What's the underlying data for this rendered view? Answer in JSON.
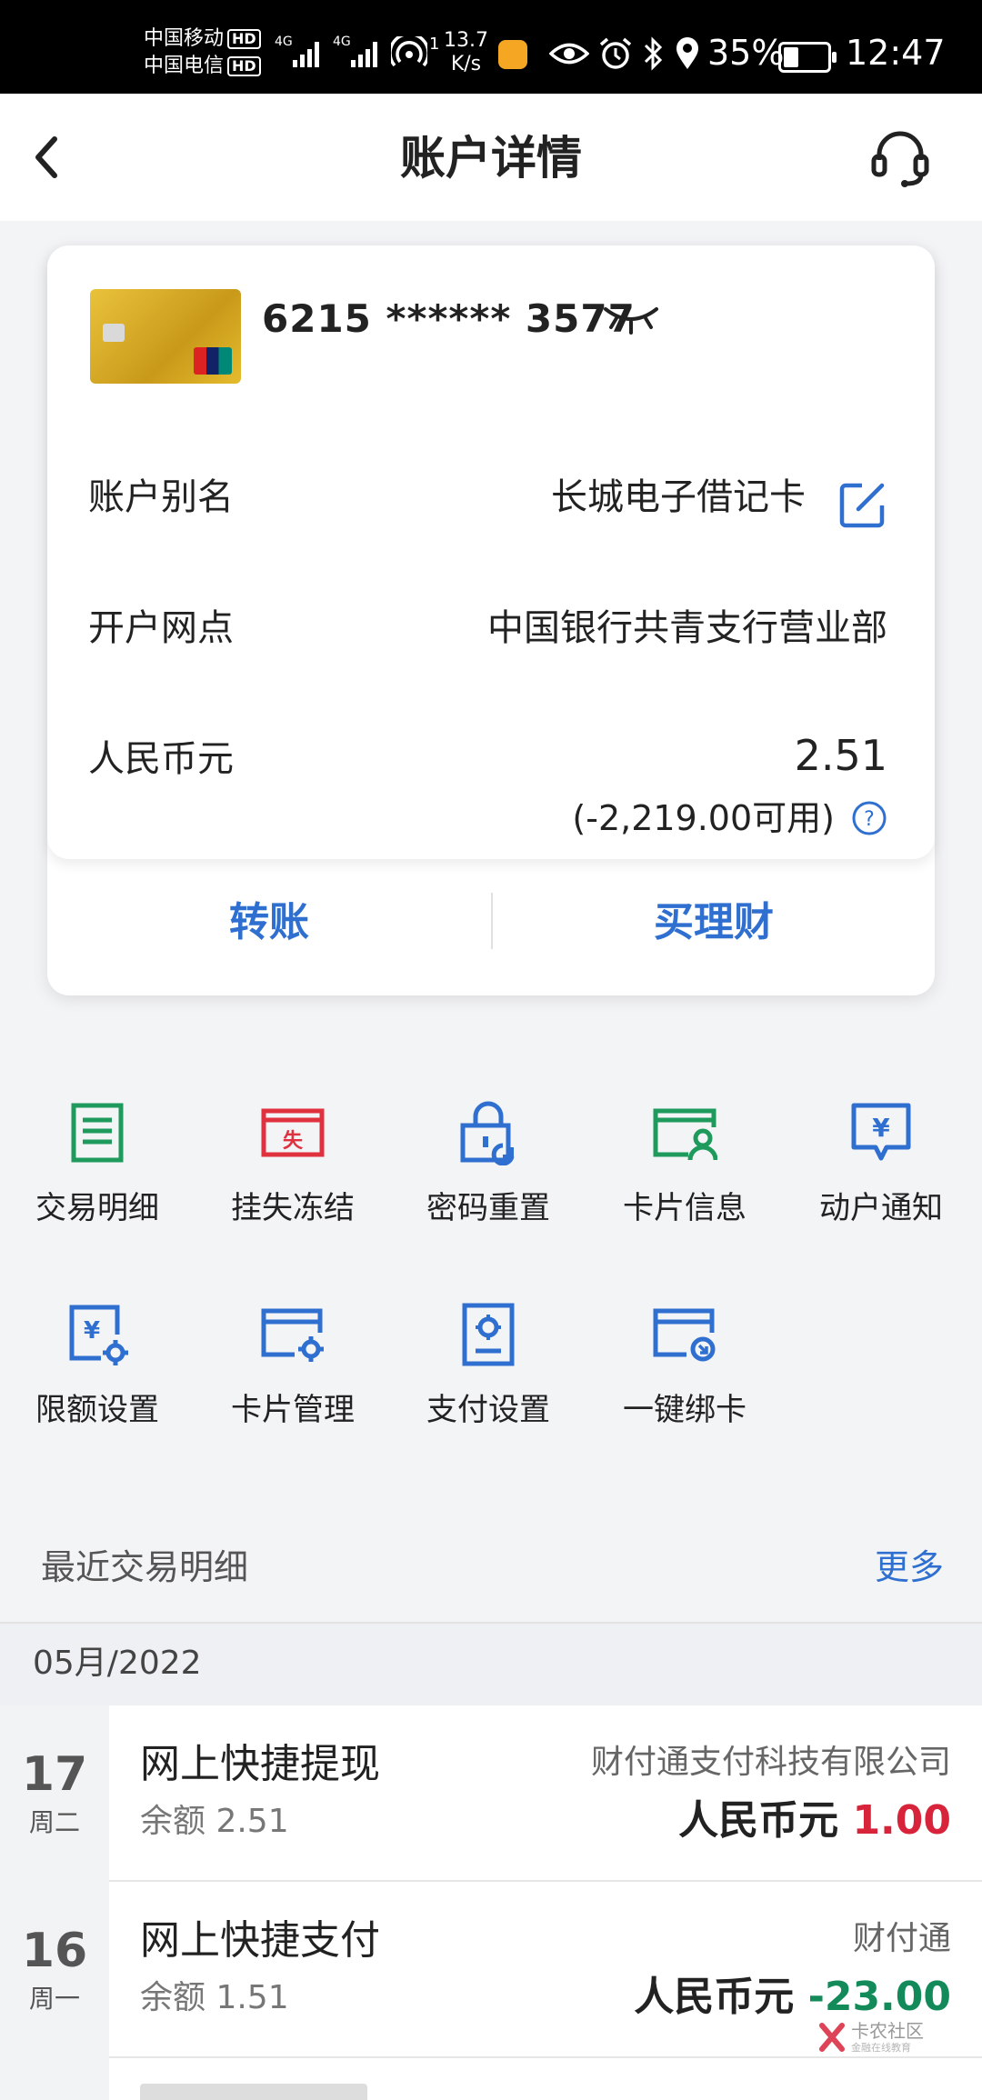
{
  "status_bar": {
    "carrier1": "中国移动",
    "carrier2": "中国电信",
    "hd": "HD",
    "net1": "4G",
    "net2": "4G",
    "hotspot_count": "1",
    "speed_value": "13.7",
    "speed_unit": "K/s",
    "battery": "35%",
    "time": "12:47"
  },
  "header": {
    "title": "账户详情"
  },
  "account": {
    "card_number": "6215 ****** 3577",
    "rows": [
      {
        "label": "账户别名",
        "value": "长城电子借记卡"
      },
      {
        "label": "开户网点",
        "value": "中国银行共青支行营业部"
      },
      {
        "label": "人民币元",
        "value": "2.51"
      }
    ],
    "available": "(-2,219.00可用)"
  },
  "actions": {
    "transfer": "转账",
    "wealth": "买理财"
  },
  "services": [
    {
      "label": "交易明细",
      "icon": "list-icon",
      "color": "#1e9a5c"
    },
    {
      "label": "挂失冻结",
      "icon": "lost-card-icon",
      "color": "#e0313e"
    },
    {
      "label": "密码重置",
      "icon": "lock-reset-icon",
      "color": "#2f6fd0"
    },
    {
      "label": "卡片信息",
      "icon": "card-user-icon",
      "color": "#1e9a5c"
    },
    {
      "label": "动户通知",
      "icon": "yuan-notify-icon",
      "color": "#2f6fd0"
    },
    {
      "label": "限额设置",
      "icon": "yuan-gear-icon",
      "color": "#2f6fd0"
    },
    {
      "label": "卡片管理",
      "icon": "card-gear-icon",
      "color": "#2f6fd0"
    },
    {
      "label": "支付设置",
      "icon": "pay-settings-icon",
      "color": "#2f6fd0"
    },
    {
      "label": "一键绑卡",
      "icon": "card-bind-icon",
      "color": "#2f6fd0"
    }
  ],
  "recent": {
    "title": "最近交易明细",
    "more": "更多",
    "month": "05月/2022",
    "transactions": [
      {
        "day": "17",
        "weekday": "周二",
        "name": "网上快捷提现",
        "balance": "余额 2.51",
        "party": "财付通支付科技有限公司",
        "currency": "人民币元",
        "amount": "1.00",
        "amount_color": "#d8243a"
      },
      {
        "day": "16",
        "weekday": "周一",
        "name": "网上快捷支付",
        "balance": "余额 1.51",
        "party": "财付通",
        "currency": "人民币元",
        "amount": "-23.00",
        "amount_color": "#128a5a"
      }
    ]
  },
  "watermark": {
    "text": "卡农社区",
    "subtext": "金融在线教育"
  }
}
